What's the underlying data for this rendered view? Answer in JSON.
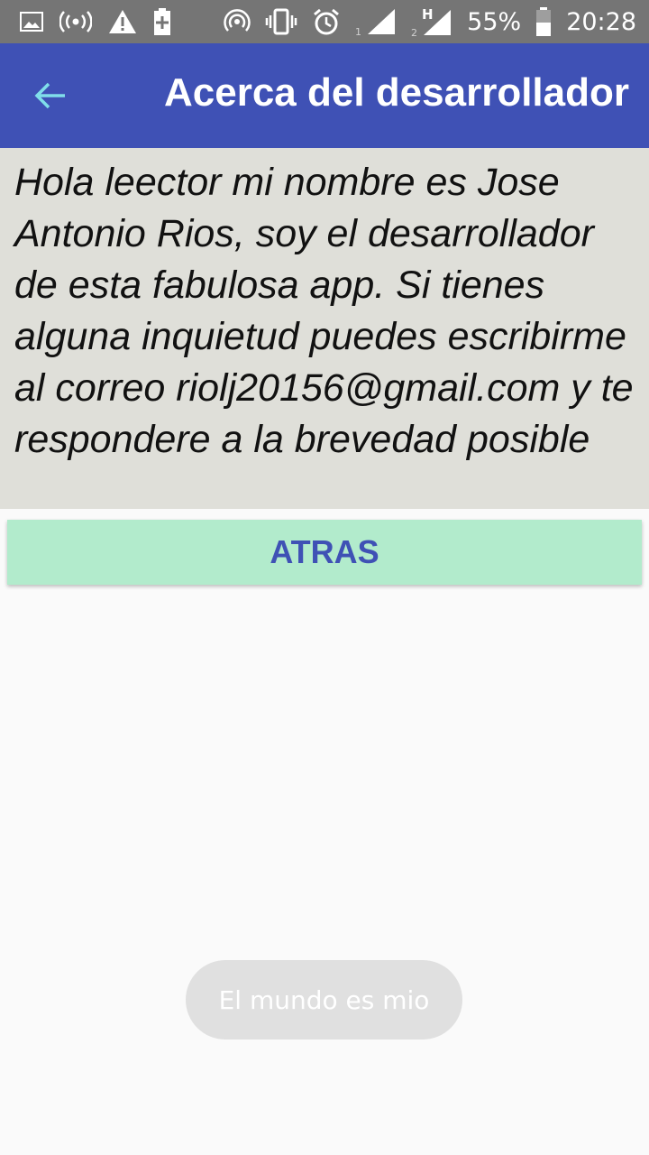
{
  "status_bar": {
    "battery_percent": "55%",
    "time": "20:28",
    "icons": [
      "image-icon",
      "hotspot-icon",
      "warning-icon",
      "battery-plus-icon",
      "wireless-icon",
      "vibrate-icon",
      "alarm-icon",
      "signal-1-icon",
      "signal-2-h-icon",
      "battery-icon"
    ],
    "sim1_label": "1",
    "sim2_label": "2",
    "network_type": "H"
  },
  "app_bar": {
    "title": "Acerca del desarrollador",
    "back_icon": "arrow-back-icon",
    "back_color": "#80deea"
  },
  "content": {
    "text": "Hola leector mi nombre es Jose Antonio Rios, soy el desarrollador de esta fabulosa app. Si tienes alguna inquietud puedes escribirme al correo riolj20156@gmail.com y te respondere a la brevedad posible"
  },
  "button": {
    "label": "ATRAS"
  },
  "toast": {
    "text": "El mundo es mio"
  },
  "colors": {
    "app_bar": "#3f51b5",
    "status_bar": "#757575",
    "content_bg": "#dfdfd9",
    "button_bg": "#b2ebcc",
    "button_text": "#3f51b5"
  }
}
